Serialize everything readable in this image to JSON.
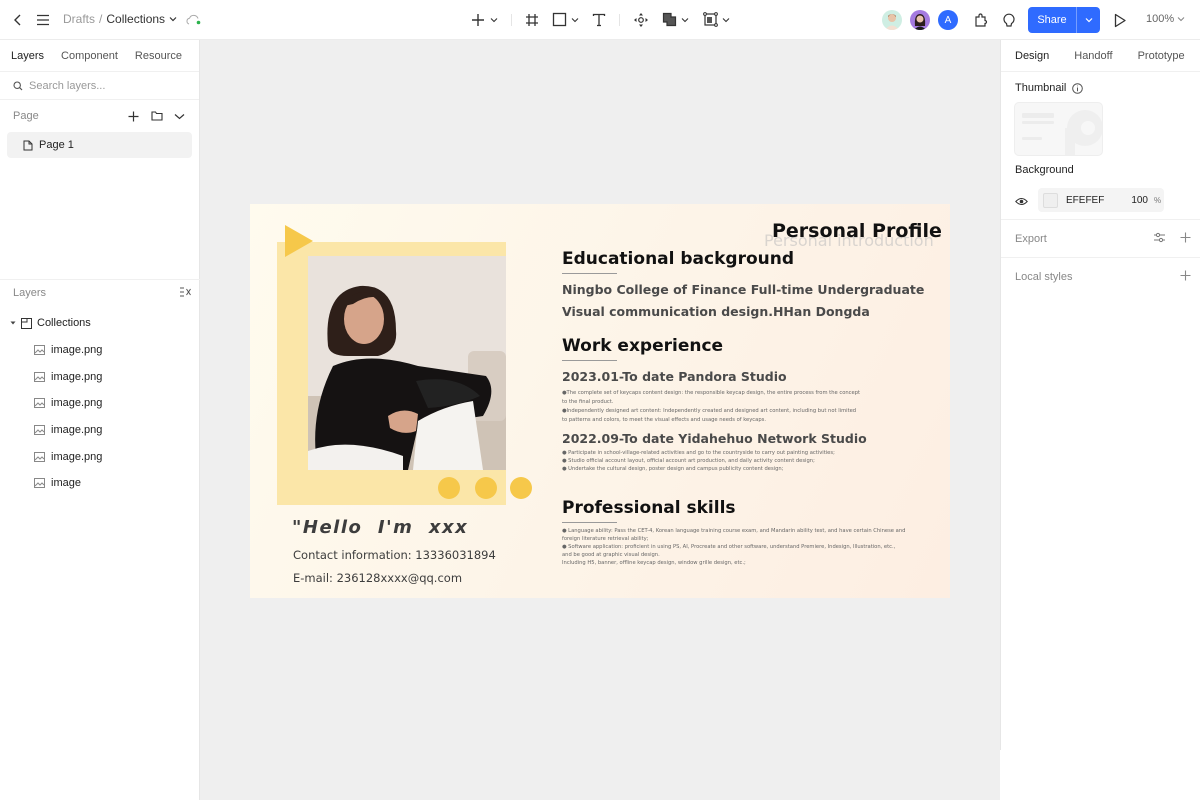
{
  "topbar": {
    "breadcrumb_root": "Drafts",
    "breadcrumb_sep": "/",
    "breadcrumb_current": "Collections",
    "share_label": "Share",
    "zoom_level": "100%",
    "avatar_initial": "A",
    "sync_status_color": "#2bb24c",
    "accent_color": "#2f6bff"
  },
  "left_panel": {
    "tabs": [
      {
        "label": "Layers",
        "active": true
      },
      {
        "label": "Component",
        "active": false
      },
      {
        "label": "Resource",
        "active": false
      }
    ],
    "search_placeholder": "Search layers...",
    "page_section_title": "Page",
    "pages": [
      {
        "label": "Page 1",
        "selected": true
      }
    ],
    "layers_section_title": "Layers",
    "layer_tree": {
      "parent": "Collections",
      "children": [
        "image.png",
        "image.png",
        "image.png",
        "image.png",
        "image.png",
        "image"
      ]
    }
  },
  "artboard": {
    "title": "Personal Profile",
    "title_shadow": "Personal introduction",
    "education": {
      "heading": "Educational background",
      "line1": "Ningbo College of Finance Full-time Undergraduate",
      "line2": "Visual communication design.HHan Dongda"
    },
    "work": {
      "heading": "Work experience",
      "job1_title": "2023.01-To date Pandora Studio",
      "job1_lines": [
        "●The complete set of keycaps content design: the responsible keycap design, the entire process from the concept",
        "to the final product.",
        "●Independently designed art content: Independently created and designed art content, including but not limited",
        "to patterns and colors, to meet the visual effects and usage needs of keycaps."
      ],
      "job2_title": "2022.09-To date Yidahehuo Network Studio",
      "job2_lines": [
        "● Participate in school-village-related activities and go to the countryside to carry out painting activities;",
        "● Studio official account layout, official account art production, and daily activity content design;",
        "● Undertake the cultural design, poster design and campus publicity content design;"
      ]
    },
    "skills": {
      "heading": "Professional skills",
      "lines": [
        "● Language ability: Pass the CET-4, Korean language training course exam, and Mandarin ability test, and have certain Chinese and",
        "foreign literature retrieval ability;",
        "● Software application: proficient in using PS, AI, Procreate and other software, understand Premiere, Indesign, Illustration, etc.,",
        "and be good at graphic visual design.",
        "    Including H5, banner, offline keycap design, window grille design, etc.;"
      ]
    },
    "greeting": "\"Hello  I'm  xxx",
    "contact": "Contact information: 13336031894",
    "email": "E-mail: 236128xxxx@qq.com",
    "accent_yellow": "#f6c84a",
    "frame_yellow": "#fbe6a8"
  },
  "right_panel": {
    "tabs": [
      {
        "label": "Design",
        "active": true
      },
      {
        "label": "Handoff",
        "active": false
      },
      {
        "label": "Prototype",
        "active": false
      }
    ],
    "thumbnail_label": "Thumbnail",
    "background_label": "Background",
    "background_hex": "EFEFEF",
    "background_opacity": "100",
    "opacity_unit": "%",
    "export_label": "Export",
    "local_styles_label": "Local styles"
  }
}
